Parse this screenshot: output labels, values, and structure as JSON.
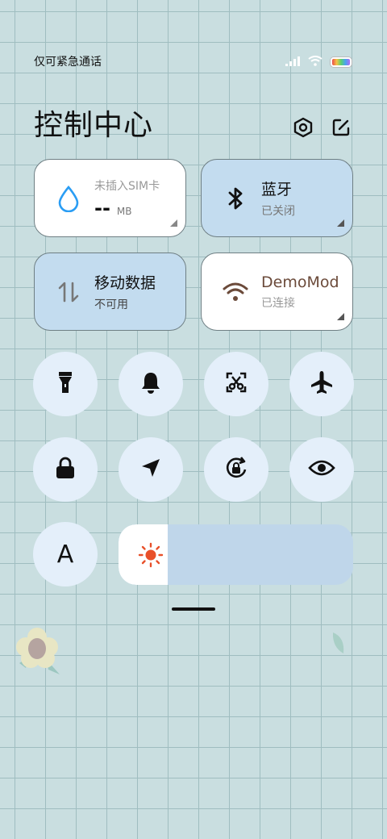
{
  "status_bar": {
    "carrier_text": "仅可紧急通话",
    "icons": [
      "signal-icon",
      "wifi-icon",
      "battery-icon"
    ]
  },
  "header": {
    "title": "控制中心",
    "icons": [
      "settings-icon",
      "edit-icon"
    ]
  },
  "tiles": {
    "data_usage": {
      "label": "未插入SIM卡",
      "value": "--",
      "unit": "MB",
      "icon": "water-drop-icon"
    },
    "bluetooth": {
      "title": "蓝牙",
      "status": "已关闭",
      "icon": "bluetooth-icon"
    },
    "mobile_data": {
      "title": "移动数据",
      "status": "不可用",
      "icon": "data-arrows-icon"
    },
    "wifi": {
      "title": "DemoMod",
      "status": "已连接",
      "icon": "wifi-icon"
    }
  },
  "toggles": [
    "flashlight-icon",
    "bell-icon",
    "screenshot-scissors-icon",
    "airplane-icon",
    "lock-icon",
    "location-arrow-icon",
    "rotation-lock-icon",
    "eye-icon"
  ],
  "font_button": {
    "label": "A"
  },
  "brightness": {
    "level": 0.21,
    "icon": "sun-icon"
  },
  "colors": {
    "background": "#c9dee0",
    "tile_active": "#c3dcef",
    "toggle_bg": "#e4effa",
    "brightness_icon": "#e8502a",
    "accent_drop": "#2a9df4"
  }
}
